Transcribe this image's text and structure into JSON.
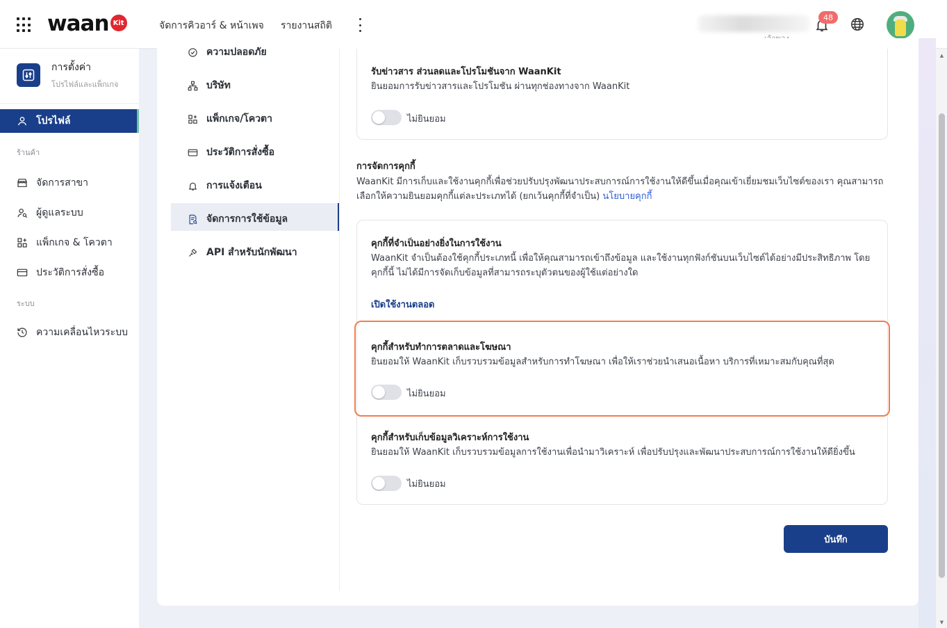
{
  "topbar": {
    "logo_text": "waan",
    "logo_badge": "Kit",
    "nav": [
      "จัดการคิวอาร์ & หน้าเพจ",
      "รายงานสถิติ"
    ],
    "user_role": "เจ้าของ",
    "notification_count": "48"
  },
  "sidebar": {
    "title": "การตั้งค่า",
    "subtitle": "โปรไฟล์และแพ็กเกจ",
    "active_item": "โปรไฟล์",
    "section_store": "ร้านค้า",
    "store_items": [
      "จัดการสาขา",
      "ผู้ดูแลระบบ",
      "แพ็กเกจ & โควตา",
      "ประวัติการสั่งซื้อ"
    ],
    "section_system": "ระบบ",
    "system_items": [
      "ความเคลื่อนไหวระบบ"
    ]
  },
  "subnav": {
    "items": [
      "ความปลอดภัย",
      "บริษัท",
      "แพ็กเกจ/โควตา",
      "ประวัติการสั่งซื้อ",
      "การแจ้งเตือน",
      "จัดการการใช้ข้อมูล",
      "API สำหรับนักพัฒนา"
    ],
    "active": "จัดการการใช้ข้อมูล"
  },
  "newsletter": {
    "title": "รับข่าวสาร ส่วนลดและโปรโมชันจาก WaanKit",
    "desc": "ยินยอมการรับข่าวสารและโปรโมชัน ผ่านทุกช่องทางจาก WaanKit",
    "toggle_label": "ไม่ยินยอม"
  },
  "cookies": {
    "heading": "การจัดการคุกกี้",
    "desc": "WaanKit มีการเก็บและใช้งานคุกกี้เพื่อช่วยปรับปรุงพัฒนาประสบการณ์การใช้งานให้ดีขึ้นเมื่อคุณเข้าเยี่ยมชมเว็บไซต์ของเรา คุณสามารถเลือกให้ความยินยอมคุกกี้แต่ละประเภทได้ (ยกเว้นคุกกี้ที่จำเป็น)",
    "policy_link": "นโยบายคุกกี้",
    "essential": {
      "title": "คุกกี้ที่จำเป็นอย่างยิ่งในการใช้งาน",
      "desc": "WaanKit จำเป็นต้องใช้คุกกี้ประเภทนี้ เพื่อให้คุณสามารถเข้าถึงข้อมูล และใช้งานทุกฟังก์ชันบนเว็บไซต์ได้อย่างมีประสิทธิภาพ โดยคุกกี้นี้ ไม่ได้มีการจัดเก็บข้อมูลที่สามารถระบุตัวตนของผู้ใช้แต่อย่างใด",
      "status": "เปิดใช้งานตลอด"
    },
    "marketing": {
      "title": "คุกกี้สำหรับทำการตลาดและโฆษณา",
      "desc": "ยินยอมให้ WaanKit เก็บรวบรวมข้อมูลสำหรับการทำโฆษณา เพื่อให้เราช่วยนำเสนอเนื้อหา บริการที่เหมาะสมกับคุณที่สุด",
      "toggle_label": "ไม่ยินยอม"
    },
    "analytics": {
      "title": "คุกกี้สำหรับเก็บข้อมูลวิเคราะห์การใช้งาน",
      "desc": "ยินยอมให้ WaanKit เก็บรวบรวมข้อมูลการใช้งานเพื่อนำมาวิเคราะห์ เพื่อปรับปรุงและพัฒนาประสบการณ์การใช้งานให้ดียิ่งขึ้น",
      "toggle_label": "ไม่ยินยอม"
    }
  },
  "save_label": "บันทึก",
  "colors": {
    "primary": "#1a3f8a",
    "highlight": "#f07e4b",
    "badge": "#f26b6b",
    "link": "#2a5bd7"
  }
}
